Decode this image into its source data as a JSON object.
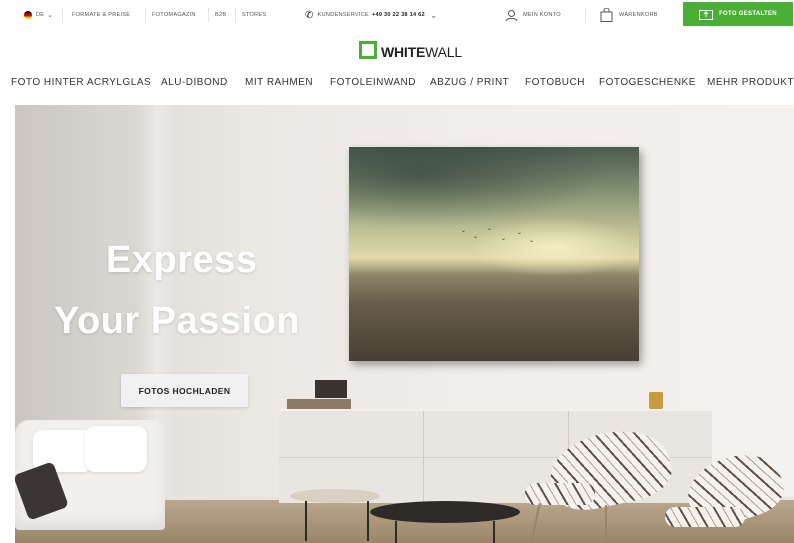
{
  "topbar": {
    "language": "DE",
    "links": [
      "FORMATE & PREISE",
      "FOTOMAGAZIN",
      "B2B",
      "STORES"
    ],
    "service_label": "KUNDENSERVICE",
    "service_phone": "+49 30 22 38 14 62",
    "account_label": "MEIN KONTO",
    "cart_label": "WARENKORB",
    "cta_label": "FOTO GESTALTEN",
    "cta_color": "#4aae37"
  },
  "logo": {
    "part1": "WHITE",
    "part2": "WALL"
  },
  "nav": {
    "items": [
      "FOTO HINTER ACRYLGLAS",
      "ALU-DIBOND",
      "MIT RAHMEN",
      "FOTOLEINWAND",
      "ABZUG / PRINT",
      "FOTOBUCH",
      "FOTOGESCHENKE",
      "MEHR PRODUKTE"
    ]
  },
  "hero": {
    "headline_line1": "Express",
    "headline_line2": "Your Passion",
    "button_label": "FOTOS HOCHLADEN"
  },
  "icons": [
    "flag-de-icon",
    "chevron-down-icon",
    "phone-icon",
    "user-icon",
    "bag-icon",
    "frame-upload-icon"
  ]
}
